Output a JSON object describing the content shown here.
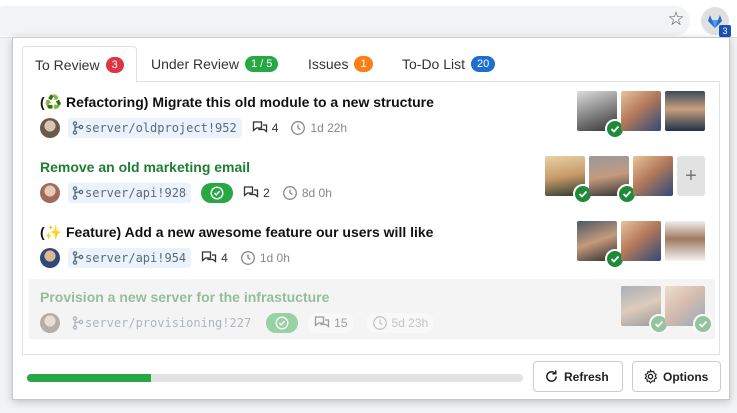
{
  "browser": {
    "extension_badge": "3"
  },
  "tabs": [
    {
      "label": "To Review",
      "count": "3",
      "color": "red"
    },
    {
      "label": "Under Review",
      "count": "1 / 5",
      "color": "green"
    },
    {
      "label": "Issues",
      "count": "1",
      "color": "orange"
    },
    {
      "label": "To-Do List",
      "count": "20",
      "color": "blue"
    }
  ],
  "merge_requests": [
    {
      "title": "(♻️ Refactoring) Migrate this old module to a new structure",
      "ref": "server/oldproject!952",
      "comments": "4",
      "age": "1d 22h",
      "pipeline": false,
      "reviewers": [
        {
          "approved": true
        },
        {
          "approved": false
        },
        {
          "approved": false
        }
      ],
      "title_color": "default",
      "faded": false
    },
    {
      "title": "Remove an old marketing email",
      "ref": "server/api!928",
      "comments": "2",
      "age": "8d 0h",
      "pipeline": true,
      "reviewers": [
        {
          "approved": true
        },
        {
          "approved": true
        },
        {
          "approved": false
        }
      ],
      "show_add": true,
      "title_color": "green",
      "faded": false
    },
    {
      "title": "(✨ Feature) Add a new awesome feature our users will like",
      "ref": "server/api!954",
      "comments": "4",
      "age": "1d 0h",
      "pipeline": false,
      "reviewers": [
        {
          "approved": true
        },
        {
          "approved": false
        },
        {
          "approved": false
        }
      ],
      "title_color": "default",
      "faded": false
    },
    {
      "title": "Provision a new server for the infrastucture",
      "ref": "server/provisioning!227",
      "comments": "15",
      "age": "5d 23h",
      "pipeline": true,
      "reviewers": [
        {
          "approved": true
        },
        {
          "approved": true
        }
      ],
      "title_color": "green",
      "faded": true
    }
  ],
  "footer": {
    "progress": 0.25,
    "refresh_label": "Refresh",
    "options_label": "Options"
  },
  "colors": {
    "accent_green": "#28a745",
    "approved_green": "#1e8a3a",
    "badge_red": "#dc3545",
    "badge_orange": "#fd7e14",
    "badge_blue": "#1f6fd1"
  }
}
